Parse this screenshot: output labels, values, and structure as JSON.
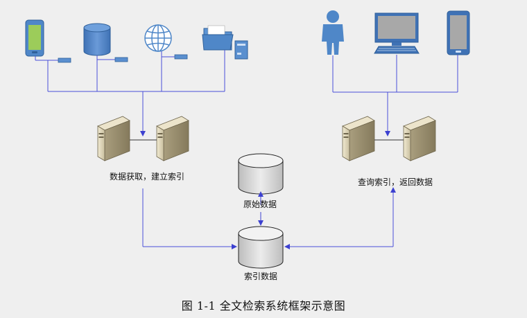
{
  "labels": {
    "acquire_server": "数据获取，建立索引",
    "query_server": "查询索引，返回数据",
    "raw_db": "原始数据",
    "index_db": "索引数据"
  },
  "caption": "图  1-1 全文检索系统框架示意图",
  "colors": {
    "connector": "#4a4fd8",
    "device_blue": "#4f87c8",
    "server_body": "#d9d2bc",
    "db_fill": "#d8d8d8"
  },
  "icons": [
    "smartphone-icon",
    "database-icon",
    "globe-icon",
    "folder-icon",
    "person-icon",
    "monitor-icon",
    "tablet-icon",
    "server-icon"
  ]
}
